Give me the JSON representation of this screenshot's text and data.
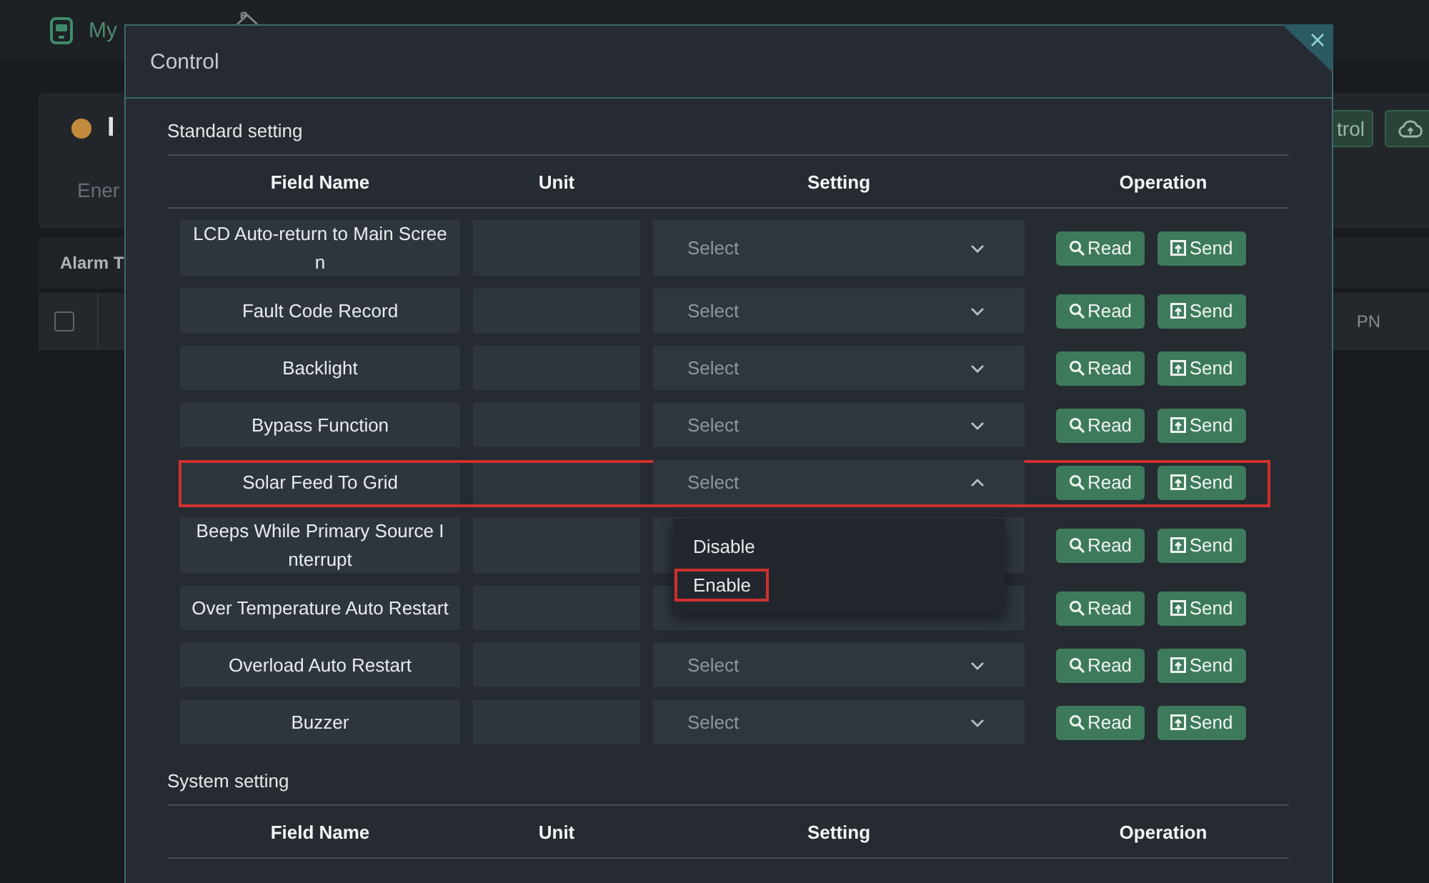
{
  "background": {
    "nav_items": [
      {
        "label": "My"
      }
    ],
    "card": {
      "title": "I",
      "subtitle": "Ener",
      "buttons": [
        {
          "kind": "text",
          "label": "trol"
        },
        {
          "kind": "icon"
        }
      ]
    },
    "alarm": {
      "title": "Alarm T",
      "checkbox": {
        "checked": false
      },
      "columns": [
        "PN"
      ]
    }
  },
  "dialog": {
    "title": "Control",
    "sections": [
      {
        "title": "Standard setting",
        "columns": [
          "Field Name",
          "Unit",
          "Setting",
          "Operation"
        ],
        "rows": [
          {
            "field_name": "LCD Auto-return to Main Screen",
            "highlighted": false,
            "setting": {
              "placeholder": "Select",
              "expanded": false
            },
            "actions": [
              {
                "kind": "read",
                "label": "Read"
              },
              {
                "kind": "send",
                "label": "Send"
              }
            ]
          },
          {
            "field_name": "Fault Code Record",
            "highlighted": false,
            "setting": {
              "placeholder": "Select",
              "expanded": false
            },
            "actions": [
              {
                "kind": "read",
                "label": "Read"
              },
              {
                "kind": "send",
                "label": "Send"
              }
            ]
          },
          {
            "field_name": "Backlight",
            "highlighted": false,
            "setting": {
              "placeholder": "Select",
              "expanded": false
            },
            "actions": [
              {
                "kind": "read",
                "label": "Read"
              },
              {
                "kind": "send",
                "label": "Send"
              }
            ]
          },
          {
            "field_name": "Bypass Function",
            "highlighted": false,
            "setting": {
              "placeholder": "Select",
              "expanded": false
            },
            "actions": [
              {
                "kind": "read",
                "label": "Read"
              },
              {
                "kind": "send",
                "label": "Send"
              }
            ]
          },
          {
            "field_name": "Solar Feed To Grid",
            "highlighted": true,
            "setting": {
              "placeholder": "Select",
              "expanded": true,
              "options": [
                {
                  "label": "Disable",
                  "highlighted": false
                },
                {
                  "label": "Enable",
                  "highlighted": true
                }
              ]
            },
            "actions": [
              {
                "kind": "read",
                "label": "Read"
              },
              {
                "kind": "send",
                "label": "Send"
              }
            ]
          },
          {
            "field_name": "Beeps While Primary Source Interrupt",
            "highlighted": false,
            "actions": [
              {
                "kind": "read",
                "label": "Read"
              },
              {
                "kind": "send",
                "label": "Send"
              }
            ]
          },
          {
            "field_name": "Over Temperature Auto Restart",
            "highlighted": false,
            "actions": [
              {
                "kind": "read",
                "label": "Read"
              },
              {
                "kind": "send",
                "label": "Send"
              }
            ]
          },
          {
            "field_name": "Overload Auto Restart",
            "highlighted": false,
            "setting": {
              "placeholder": "Select",
              "expanded": false
            },
            "actions": [
              {
                "kind": "read",
                "label": "Read"
              },
              {
                "kind": "send",
                "label": "Send"
              }
            ]
          },
          {
            "field_name": "Buzzer",
            "highlighted": false,
            "setting": {
              "placeholder": "Select",
              "expanded": false
            },
            "actions": [
              {
                "kind": "read",
                "label": "Read"
              },
              {
                "kind": "send",
                "label": "Send"
              }
            ]
          }
        ]
      },
      {
        "title": "System setting",
        "columns": [
          "Field Name",
          "Unit",
          "Setting",
          "Operation"
        ]
      }
    ]
  }
}
